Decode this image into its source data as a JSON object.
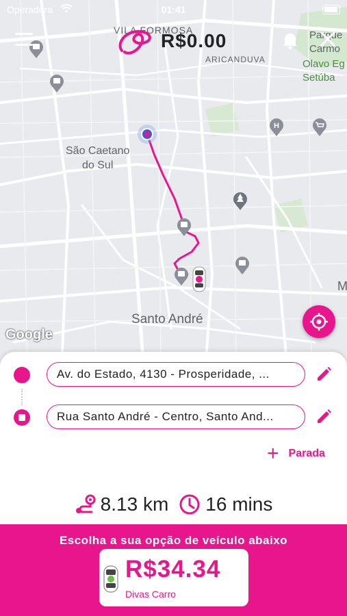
{
  "status_bar": {
    "carrier": "Operadora",
    "time": "01:41"
  },
  "header": {
    "balance": "R$0.00"
  },
  "map": {
    "labels": {
      "vila_formosa": "VILA FORMOSA",
      "aricanduva": "ARICANDUVA",
      "parque_carmo": "Parque\nCarmo",
      "olavo": "Olavo Eg\nSetúba",
      "sao_caetano": "São Caetano\ndo Sul",
      "santo_andre": "Santo André",
      "m": "M"
    },
    "google": "Google"
  },
  "route": {
    "origin": "Av. do Estado, 4130 - Prosperidade, ...",
    "destination": "Rua Santo André - Centro, Santo And...",
    "stop_label": "Parada"
  },
  "trip": {
    "distance": "8.13 km",
    "duration": "16 mins"
  },
  "vehicle_panel": {
    "title": "Escolha a sua opção de veículo abaixo",
    "option": {
      "price": "R$34.34",
      "name": "Divas Carro"
    }
  },
  "colors": {
    "accent": "#e9158c"
  }
}
